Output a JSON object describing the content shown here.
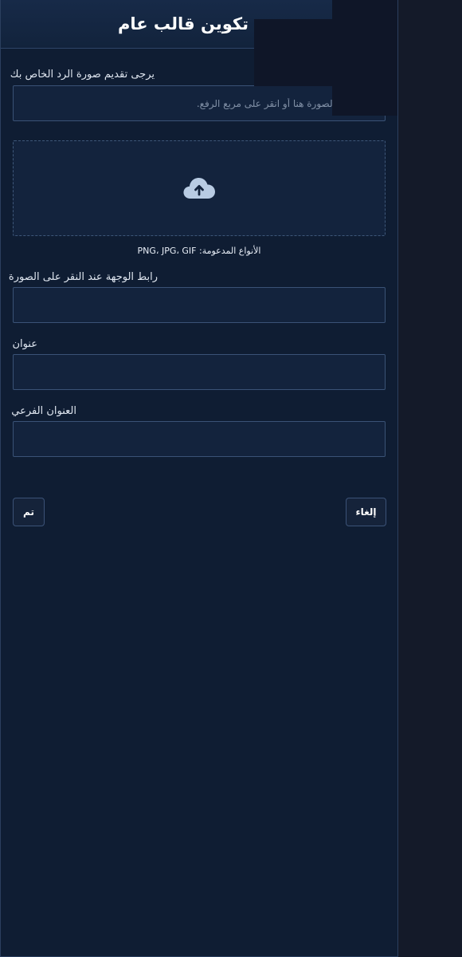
{
  "header": {
    "title": "تكوين قالب عام"
  },
  "image_section": {
    "label": "يرجى تقديم صورة الرد الخاص بك",
    "url_placeholder": "ضع رابط الصورة هنا أو انقر على مربع الرفع.",
    "upload_icon": "cloud-upload-icon",
    "supported_types": "الأنواع المدعومة: PNG، JPG، GIF"
  },
  "fields": {
    "link_label": "رابط الوجهة عند النقر على الصورة",
    "link_value": "",
    "title_label": "عنوان",
    "title_value": "",
    "subtitle_label": "العنوان الفرعي",
    "subtitle_value": ""
  },
  "actions": {
    "done_label": "تم",
    "cancel_label": "إلغاء"
  },
  "colors": {
    "panel_bg": "#0f1d33",
    "field_bg": "#13233d",
    "border": "#3a5276",
    "icon": "#b8cbe3"
  }
}
